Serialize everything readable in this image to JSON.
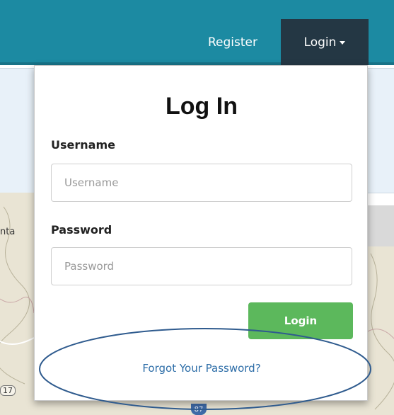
{
  "navbar": {
    "register_label": "Register",
    "login_label": "Login",
    "background": "#1c8aa2",
    "active_background": "#243744"
  },
  "background_map": {
    "place_label": "nta",
    "route_17": "17",
    "route_87": "87"
  },
  "login_dropdown": {
    "title": "Log In",
    "username": {
      "label": "Username",
      "placeholder": "Username",
      "value": ""
    },
    "password": {
      "label": "Password",
      "placeholder": "Password",
      "value": ""
    },
    "submit_label": "Login",
    "submit_color": "#5cb85c",
    "forgot_link": "Forgot Your Password?",
    "annotation_color": "#2f5b8e"
  }
}
